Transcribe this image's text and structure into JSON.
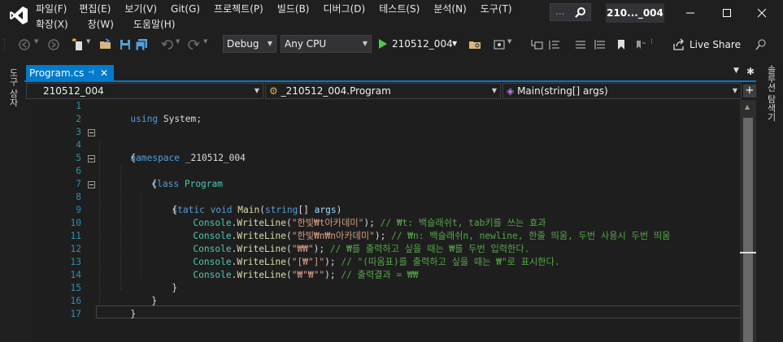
{
  "menu": {
    "row1": [
      "파일(F)",
      "편집(E)",
      "보기(V)",
      "Git(G)",
      "프로젝트(P)",
      "빌드(B)",
      "디버그(D)",
      "테스트(S)",
      "분석(N)",
      "도구(T)"
    ],
    "row2": [
      "확장(X)",
      "창(W)",
      "도움말(H)"
    ]
  },
  "search": {
    "placeholder": "..."
  },
  "solution_title": "210..._004",
  "toolbar": {
    "configuration": "Debug",
    "platform": "Any CPU",
    "start_label": "210512_004",
    "live_share": "Live Share"
  },
  "side_panels": {
    "left": "도구 상자",
    "right": "솔루션 탐색기"
  },
  "tab": {
    "title": "Program.cs",
    "pin": "⊣",
    "close": "✕"
  },
  "nav": {
    "project": "210512_004",
    "type": "_210512_004.Program",
    "member": "Main(string[] args)"
  },
  "code": {
    "line_numbers": [
      "1",
      "2",
      "3",
      "4",
      "5",
      "6",
      "7",
      "8",
      "9",
      "10",
      "11",
      "12",
      "13",
      "14",
      "15",
      "16",
      "17"
    ],
    "l1_kw": "using",
    "l1_rest": " System;",
    "l3_kw": "namespace",
    "l3_rest": " _210512_004",
    "l4": "{",
    "l5_kw": "class",
    "l5_cls": " Program",
    "l6": "{",
    "l7_kw1": "static",
    "l7_kw2": " void",
    "l7_m": " Main",
    "l7_p1": "(",
    "l7_kw3": "string",
    "l7_p2": "[] ",
    "l7_id": "args",
    "l7_p3": ")",
    "l8": "{",
    "l9_cls": "Console",
    "l9_dot": ".",
    "l9_m": "WriteLine",
    "l9_p1": "(",
    "l9_str": "\"한빛₩t아카데미\"",
    "l9_p2": "); ",
    "l9_cmt": "// ₩t: 백슬래쉬t, tab키를 쓰는 효과",
    "l10_cls": "Console",
    "l10_dot": ".",
    "l10_m": "WriteLine",
    "l10_p1": "(",
    "l10_str": "\"한빛₩n₩n아카데미\"",
    "l10_p2": "); ",
    "l10_cmt": "// ₩n: 백슬래쉬n, newline, 한줄 띄움, 두번 사용시 두번 띄움",
    "l11_cls": "Console",
    "l11_dot": ".",
    "l11_m": "WriteLine",
    "l11_p1": "(",
    "l11_str": "\"₩₩\"",
    "l11_p2": "); ",
    "l11_cmt": "// ₩를 출력하고 싶을 때는 ₩를 두번 입력한다.",
    "l12_cls": "Console",
    "l12_dot": ".",
    "l12_m": "WriteLine",
    "l12_p1": "(",
    "l12_str": "\"[₩\"]\"",
    "l12_p2": "); ",
    "l12_cmt": "// \"(따옴표)를 출력하고 싶을 때는 ₩\"로 표시한다.",
    "l13_cls": "Console",
    "l13_dot": ".",
    "l13_m": "WriteLine",
    "l13_p1": "(",
    "l13_str": "\"₩\"₩\"\"",
    "l13_p2": "); ",
    "l13_cmt": "// 출력결과 = ₩₩",
    "l14": "}",
    "l15": "}",
    "l16": "}"
  },
  "colors": {
    "accent": "#007acc",
    "keyword": "#569cd6",
    "type": "#4ec9b0",
    "method": "#dcdcaa",
    "string": "#d69d85",
    "comment": "#57a64a",
    "line_number": "#2b91af"
  },
  "icons": [
    "visual-studio-logo-icon",
    "search-icon",
    "minimize-icon",
    "maximize-icon",
    "close-icon",
    "back-icon",
    "forward-icon",
    "new-project-icon",
    "open-folder-icon",
    "save-icon",
    "save-all-icon",
    "undo-icon",
    "redo-icon",
    "play-icon",
    "live-share-icon",
    "gear-icon",
    "split-editor-icon"
  ]
}
